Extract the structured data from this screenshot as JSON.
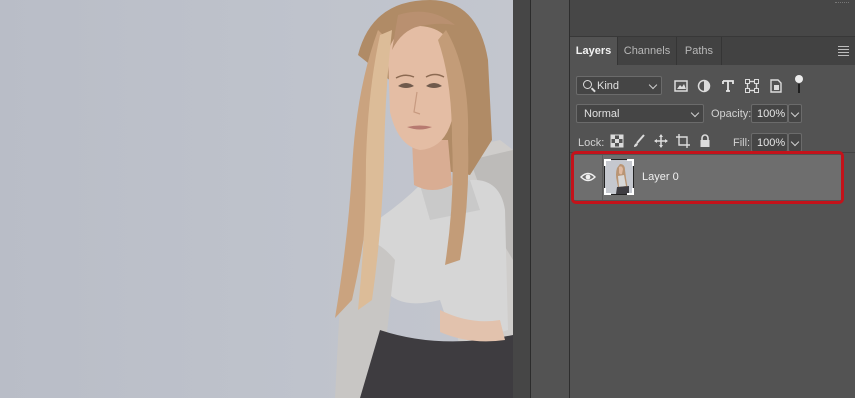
{
  "panel": {
    "tabs": [
      "Layers",
      "Channels",
      "Paths"
    ],
    "active_tab": "Layers"
  },
  "filter": {
    "kind_label": "Kind",
    "icons": [
      "pixel-layer-filter-icon",
      "adjustment-layer-filter-icon",
      "type-layer-filter-icon",
      "shape-layer-filter-icon",
      "smart-object-filter-icon"
    ]
  },
  "blend": {
    "mode": "Normal",
    "opacity_label": "Opacity:",
    "opacity_value": "100%",
    "lock_label": "Lock:",
    "fill_label": "Fill:",
    "fill_value": "100%"
  },
  "layers": [
    {
      "name": "Layer 0",
      "visible": true
    }
  ],
  "colors": {
    "panel_bg": "#535353",
    "selected_row": "#6e6e6e",
    "highlight_outline": "#c4121a"
  }
}
